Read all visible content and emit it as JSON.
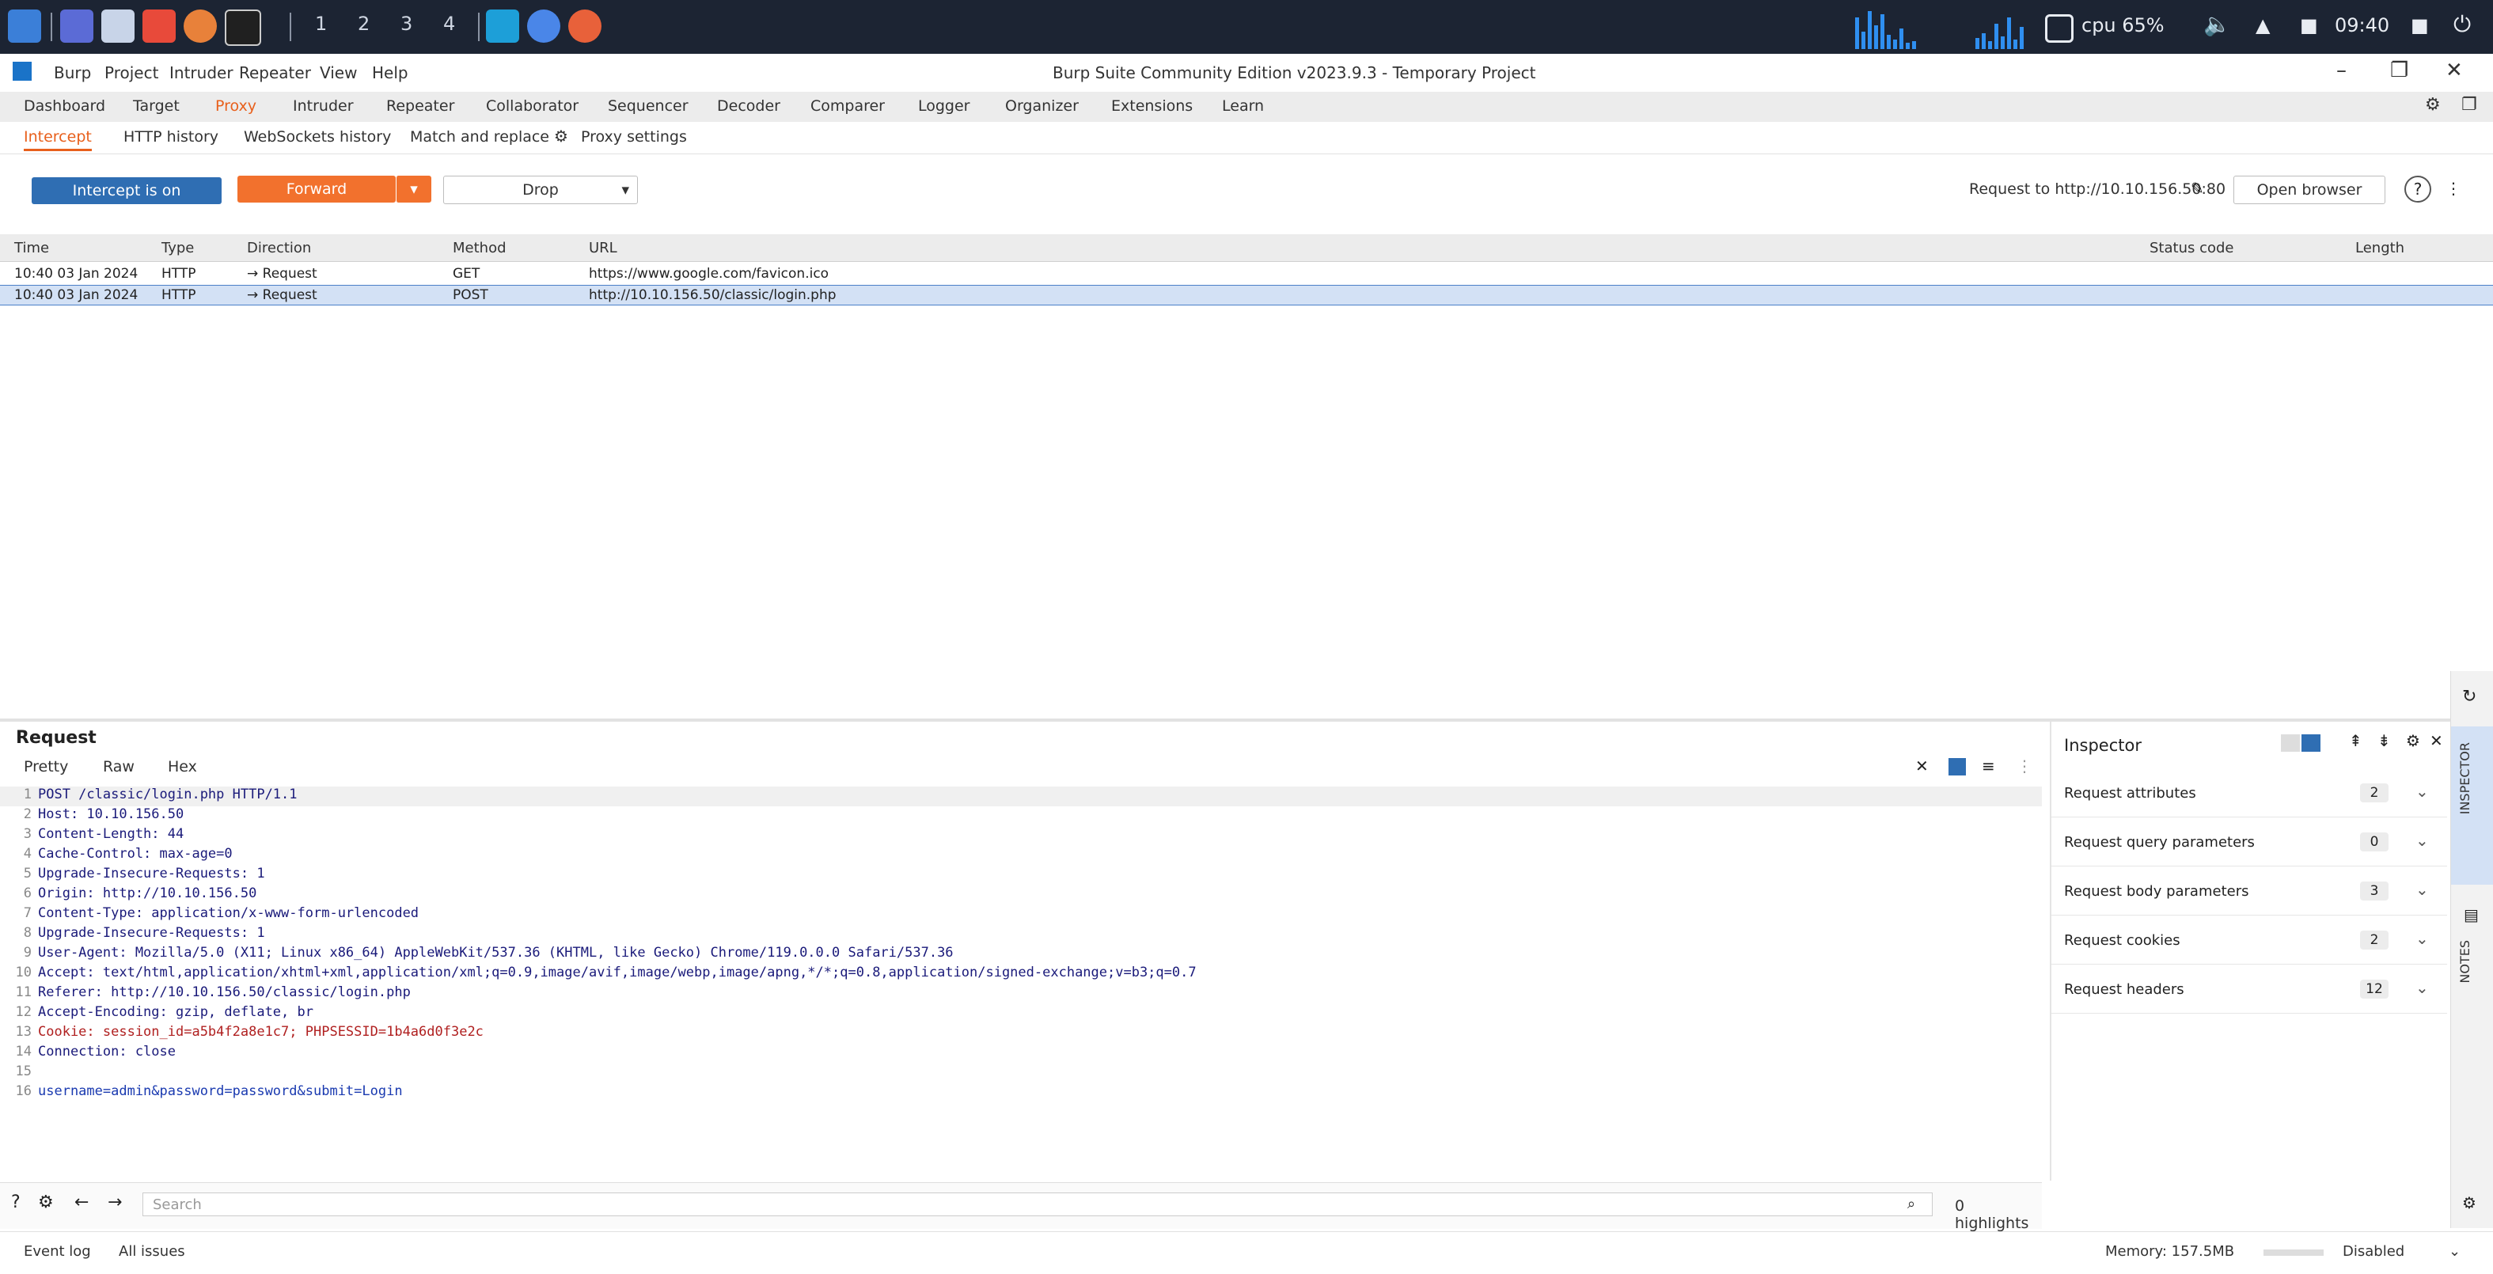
{
  "taskbar": {
    "workspaces": [
      "1",
      "2",
      "3",
      "4"
    ],
    "tray_text": "cpu  65%",
    "clock": "09:40"
  },
  "window": {
    "app_icon": "burp-icon",
    "menus": [
      "Burp",
      "Project",
      "Intruder",
      "Repeater",
      "View",
      "Help"
    ],
    "title": "Burp Suite Community Edition v2023.9.3 - Temporary Project",
    "controls": [
      "–",
      "❐",
      "✕"
    ]
  },
  "main_tabs": [
    "Dashboard",
    "Target",
    "Proxy",
    "Intruder",
    "Repeater",
    "Collaborator",
    "Sequencer",
    "Decoder",
    "Comparer",
    "Logger",
    "Organizer",
    "Extensions",
    "Learn"
  ],
  "main_tab_active": "Proxy",
  "sub_tabs": [
    "Intercept",
    "HTTP history",
    "WebSockets history",
    "Match and replace",
    "Proxy settings"
  ],
  "sub_tab_active": "Intercept",
  "toolbar": {
    "intercept_label": "Intercept is on",
    "forward_label": "Forward",
    "drop_label": "Drop",
    "request_to": "Request to http://10.10.156.50:80",
    "open_browser_label": "Open browser"
  },
  "table": {
    "headers": [
      "Time",
      "Type",
      "Direction",
      "Method",
      "URL",
      "Status code",
      "Length"
    ],
    "rows": [
      {
        "time": "10:40 03 Jan 2024",
        "type": "HTTP",
        "direction": "→ Request",
        "method": "GET",
        "url": "https://www.google.com/favicon.ico",
        "status": "",
        "length": ""
      },
      {
        "time": "10:40 03 Jan 2024",
        "type": "HTTP",
        "direction": "→ Request",
        "method": "POST",
        "url": "http://10.10.156.50/classic/login.php",
        "status": "",
        "length": ""
      }
    ]
  },
  "request": {
    "title": "Request",
    "tabs": [
      "Pretty",
      "Raw",
      "Hex"
    ],
    "lines": [
      "POST /classic/login.php HTTP/1.1",
      "Host: 10.10.156.50",
      "Content-Length: 44",
      "Cache-Control: max-age=0",
      "Upgrade-Insecure-Requests: 1",
      "Origin: http://10.10.156.50",
      "Content-Type: application/x-www-form-urlencoded",
      "Upgrade-Insecure-Requests: 1",
      "User-Agent: Mozilla/5.0 (X11; Linux x86_64) AppleWebKit/537.36 (KHTML, like Gecko) Chrome/119.0.0.0 Safari/537.36",
      "Accept: text/html,application/xhtml+xml,application/xml;q=0.9,image/avif,image/webp,image/apng,*/*;q=0.8,application/signed-exchange;v=b3;q=0.7",
      "Referer: http://10.10.156.50/classic/login.php",
      "Accept-Encoding: gzip, deflate, br",
      "Cookie: session_id=a5b4f2a8e1c7; PHPSESSID=1b4a6d0f3e2c",
      "Connection: close",
      "",
      "username=admin&password=password&submit=Login"
    ],
    "search_placeholder": "Search",
    "highlights": "0 highlights"
  },
  "inspector": {
    "title": "Inspector",
    "sections": [
      {
        "label": "Request attributes",
        "count": "2"
      },
      {
        "label": "Request query parameters",
        "count": "0"
      },
      {
        "label": "Request body parameters",
        "count": "3"
      },
      {
        "label": "Request cookies",
        "count": "2"
      },
      {
        "label": "Request headers",
        "count": "12"
      }
    ],
    "rail": [
      "INSPECTOR",
      "NOTES"
    ]
  },
  "statusbar": {
    "left1": "Event log",
    "left2": "All issues",
    "memory": "Memory: 157.5MB",
    "disabled": "Disabled"
  }
}
